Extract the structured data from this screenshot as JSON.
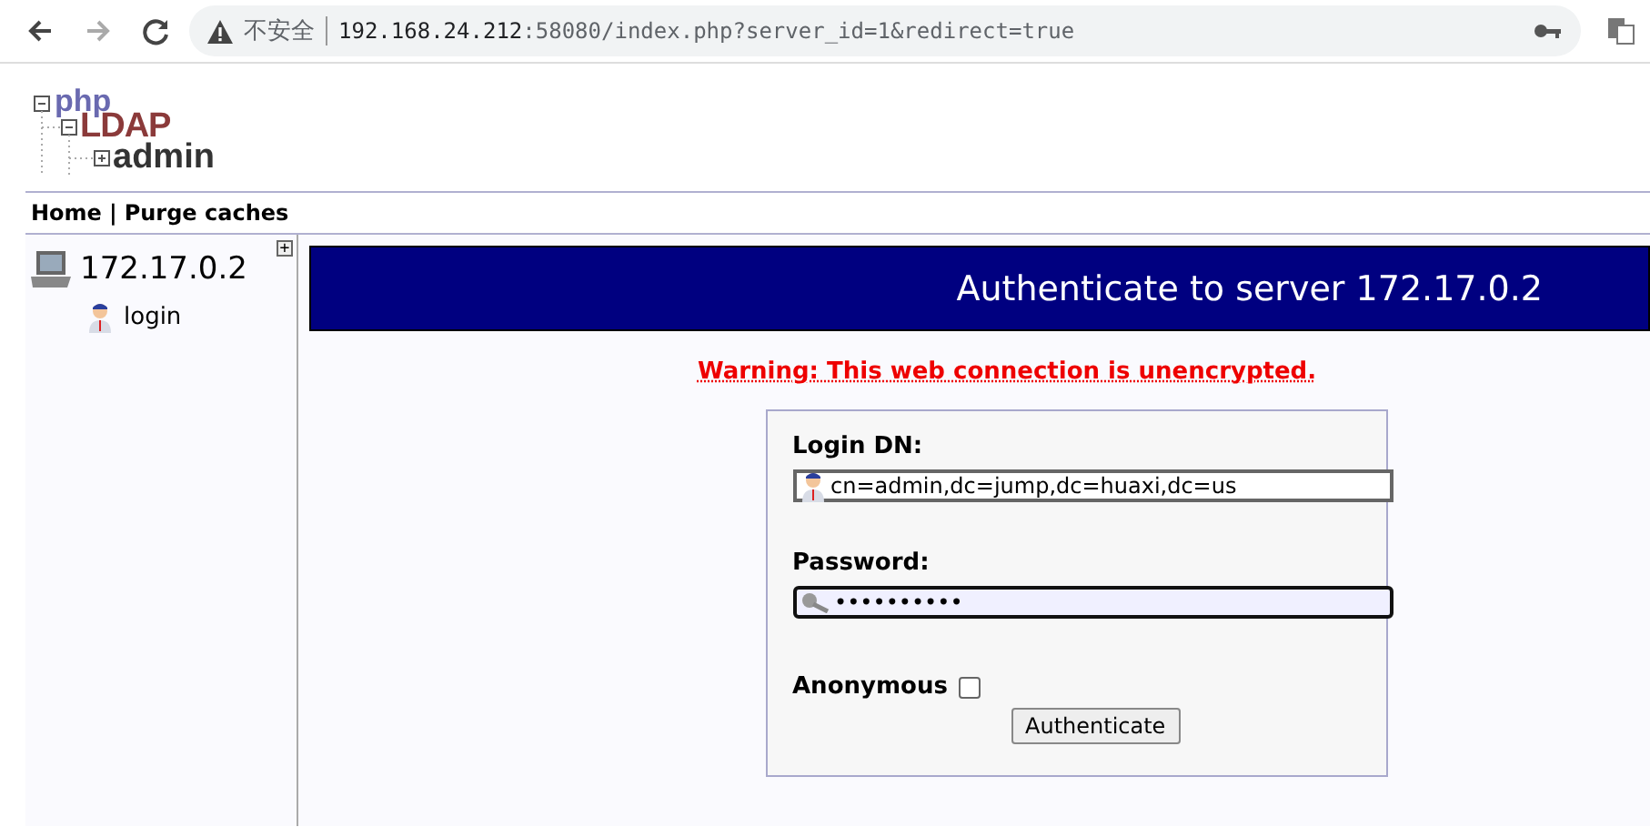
{
  "browser": {
    "security_label": "不安全",
    "url_host": "192.168.24.212",
    "url_rest": ":58080/index.php?server_id=1&redirect=true"
  },
  "logo": {
    "line1": "php",
    "line2": "LDAP",
    "line3": "admin"
  },
  "nav": {
    "links": [
      "Home",
      "Purge caches"
    ],
    "separator": "|"
  },
  "tree": {
    "expand_symbol": "+",
    "server": "172.17.0.2",
    "items": [
      {
        "label": "login"
      }
    ]
  },
  "header": {
    "title": "Authenticate to server 172.17.0.2"
  },
  "warning": "Warning: This web connection is unencrypted.",
  "form": {
    "login_label": "Login DN:",
    "login_value": "cn=admin,dc=jump,dc=huaxi,dc=us",
    "password_label": "Password:",
    "password_value": "••••••••••",
    "password_focused": true,
    "anonymous_label": "Anonymous",
    "anonymous_checked": false,
    "submit": "Authenticate"
  }
}
